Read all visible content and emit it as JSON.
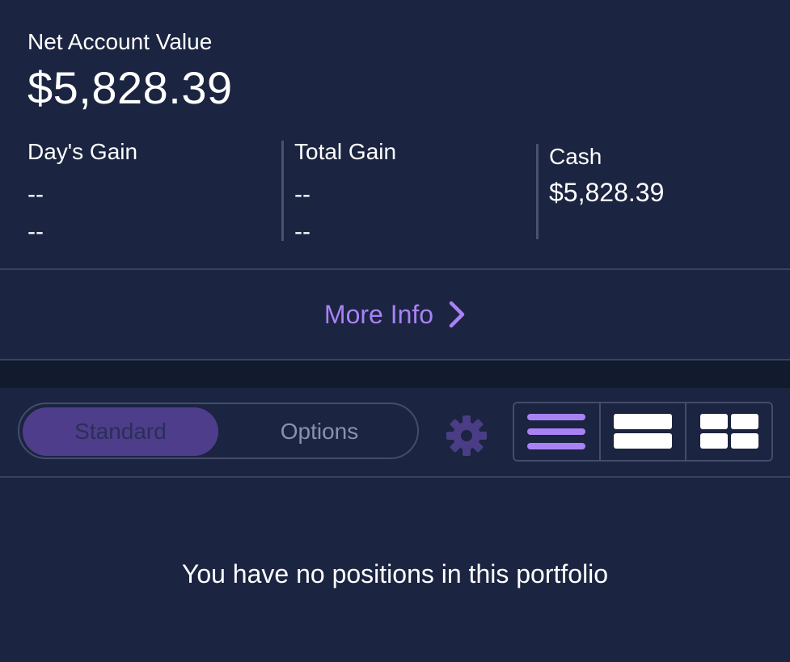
{
  "summary": {
    "net_account_value_label": "Net Account Value",
    "net_account_value": "$5,828.39",
    "days_gain": {
      "label": "Day's Gain",
      "value": "--",
      "percent": "--"
    },
    "total_gain": {
      "label": "Total Gain",
      "value": "--",
      "percent": "--"
    },
    "cash": {
      "label": "Cash",
      "value": "$5,828.39"
    }
  },
  "more_info": {
    "label": "More Info",
    "icon": "chevron-right-icon"
  },
  "toolbar": {
    "tabs": [
      {
        "label": "Standard",
        "selected": true
      },
      {
        "label": "Options",
        "selected": false
      }
    ],
    "settings_icon": "gear-icon",
    "view_modes": [
      {
        "icon": "list-view-icon",
        "selected": true
      },
      {
        "icon": "row-view-icon",
        "selected": false
      },
      {
        "icon": "grid-view-icon",
        "selected": false
      }
    ]
  },
  "empty_state": {
    "message": "You have no positions in this portfolio"
  },
  "colors": {
    "background": "#1b2440",
    "accent": "#a882f5",
    "tab_selected": "#4e3d8a",
    "divider": "#3a4261"
  }
}
